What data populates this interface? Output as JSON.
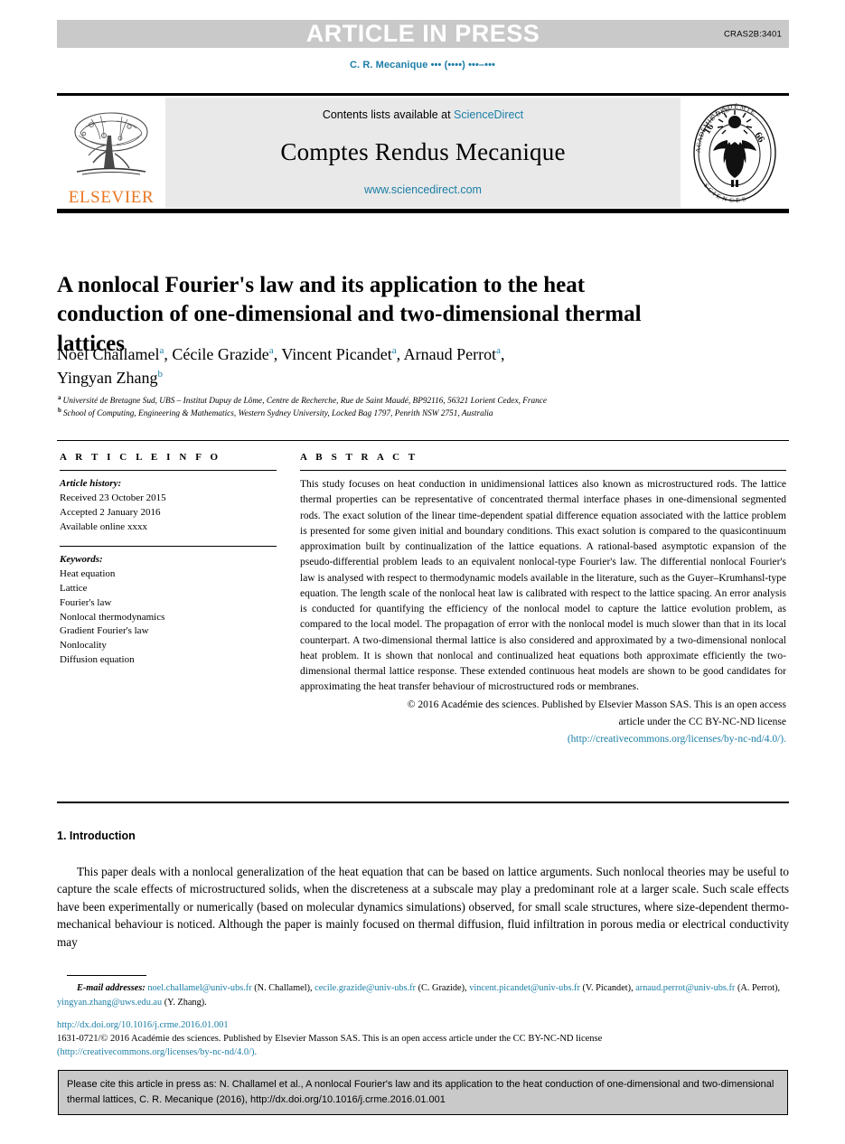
{
  "banner": {
    "label": "ARTICLE IN PRESS",
    "code": "CRAS2B:3401",
    "band_color": "#c9c9c9"
  },
  "running_head": "C. R. Mecanique ••• (••••) •••–•••",
  "journal_header": {
    "contents_prefix": "Contents lists available at ",
    "contents_link": "ScienceDirect",
    "title": "Comptes Rendus Mecanique",
    "url": "www.sciencedirect.com",
    "publisher_logo_text": "ELSEVIER",
    "publisher_logo_color": "#e87722",
    "academy_seal_text": "INSTITUT DE FRANCE ACADÉMIE DES SCIENCES 1666",
    "link_color": "#1b7ea6",
    "panel_color": "#e9e9e9"
  },
  "article": {
    "title": "A nonlocal Fourier's law and its application to the heat conduction of one-dimensional and two-dimensional thermal lattices",
    "authors": [
      {
        "name": "Noël Challamel",
        "mark": "a",
        "sep": ", "
      },
      {
        "name": "Cécile Grazide",
        "mark": "a",
        "sep": ", "
      },
      {
        "name": "Vincent Picandet",
        "mark": "a",
        "sep": ", "
      },
      {
        "name": "Arnaud Perrot",
        "mark": "a",
        "sep": ","
      },
      {
        "name": "Yingyan Zhang",
        "mark": "b",
        "sep": ""
      }
    ],
    "affiliations": [
      {
        "mark": "a",
        "text": "Université de Bretagne Sud, UBS – Institut Dupuy de Lôme, Centre de Recherche, Rue de Saint Maudé, BP92116, 56321 Lorient Cedex, France"
      },
      {
        "mark": "b",
        "text": "School of Computing, Engineering & Mathematics, Western Sydney University, Locked Bag 1797, Penrith NSW 2751, Australia"
      }
    ]
  },
  "info": {
    "heading": "A R T I C L E   I N F O",
    "history_label": "Article history:",
    "history": [
      "Received 23 October 2015",
      "Accepted 2 January 2016",
      "Available online xxxx"
    ],
    "keywords_label": "Keywords:",
    "keywords": [
      "Heat equation",
      "Lattice",
      "Fourier's law",
      "Nonlocal thermodynamics",
      "Gradient Fourier's law",
      "Nonlocality",
      "Diffusion equation"
    ]
  },
  "abstract": {
    "heading": "A B S T R A C T",
    "body": "This study focuses on heat conduction in unidimensional lattices also known as microstructured rods. The lattice thermal properties can be representative of concentrated thermal interface phases in one-dimensional segmented rods. The exact solution of the linear time-dependent spatial difference equation associated with the lattice problem is presented for some given initial and boundary conditions. This exact solution is compared to the quasicontinuum approximation built by continualization of the lattice equations. A rational-based asymptotic expansion of the pseudo-differential problem leads to an equivalent nonlocal-type Fourier's law. The differential nonlocal Fourier's law is analysed with respect to thermodynamic models available in the literature, such as the Guyer–Krumhansl-type equation. The length scale of the nonlocal heat law is calibrated with respect to the lattice spacing. An error analysis is conducted for quantifying the efficiency of the nonlocal model to capture the lattice evolution problem, as compared to the local model. The propagation of error with the nonlocal model is much slower than that in its local counterpart. A two-dimensional thermal lattice is also considered and approximated by a two-dimensional nonlocal heat problem. It is shown that nonlocal and continualized heat equations both approximate efficiently the two-dimensional thermal lattice response. These extended continuous heat models are shown to be good candidates for approximating the heat transfer behaviour of microstructured rods or membranes.",
    "copyright_line1": "© 2016 Académie des sciences. Published by Elsevier Masson SAS. This is an open access",
    "copyright_line2": "article under the CC BY-NC-ND license",
    "license_url": "(http://creativecommons.org/licenses/by-nc-nd/4.0/)."
  },
  "introduction": {
    "heading": "1. Introduction",
    "paragraph": "This paper deals with a nonlocal generalization of the heat equation that can be based on lattice arguments. Such nonlocal theories may be useful to capture the scale effects of microstructured solids, when the discreteness at a subscale may play a predominant role at a larger scale. Such scale effects have been experimentally or numerically (based on molecular dynamics simulations) observed, for small scale structures, where size-dependent thermo-mechanical behaviour is noticed. Although the paper is mainly focused on thermal diffusion, fluid infiltration in porous media or electrical conductivity may"
  },
  "footnotes": {
    "email_label": "E-mail addresses:",
    "emails": [
      {
        "address": "noel.challamel@univ-ubs.fr",
        "person": "(N. Challamel)",
        "sep": ", "
      },
      {
        "address": "cecile.grazide@univ-ubs.fr",
        "person": "(C. Grazide)",
        "sep": ", "
      },
      {
        "address": "vincent.picandet@univ-ubs.fr",
        "person": "(V. Picandet)",
        "sep": ", "
      },
      {
        "address": "arnaud.perrot@univ-ubs.fr",
        "person": "(A. Perrot)",
        "sep": ", "
      },
      {
        "address": "yingyan.zhang@uws.edu.au",
        "person": "(Y. Zhang)",
        "sep": "."
      }
    ],
    "doi": "http://dx.doi.org/10.1016/j.crme.2016.01.001",
    "copyright": "1631-0721/© 2016 Académie des sciences. Published by Elsevier Masson SAS. This is an open access article under the CC BY-NC-ND license",
    "license_url": "(http://creativecommons.org/licenses/by-nc-nd/4.0/)."
  },
  "cite_box": {
    "text": "Please cite this article in press as: N. Challamel et al., A nonlocal Fourier's law and its application to the heat conduction of one-dimensional and two-dimensional thermal lattices, C. R. Mecanique (2016), http://dx.doi.org/10.1016/j.crme.2016.01.001",
    "background": "#c9c9c9"
  }
}
